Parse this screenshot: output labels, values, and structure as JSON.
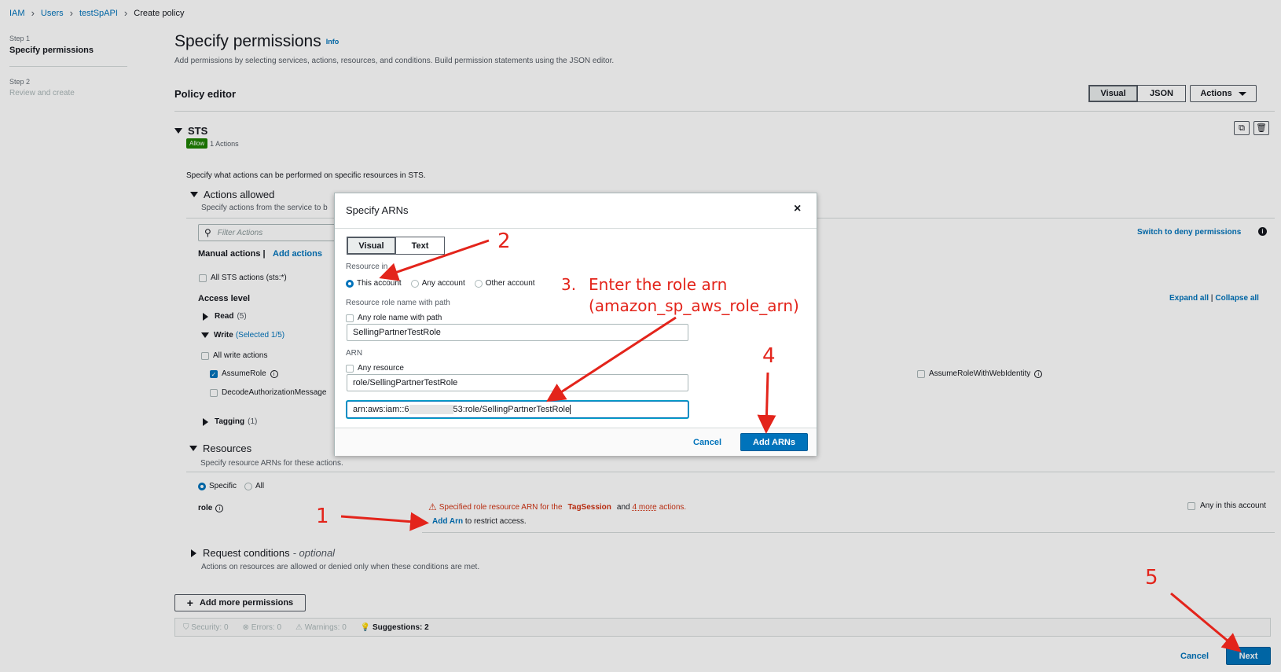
{
  "breadcrumb": {
    "iam": "IAM",
    "users": "Users",
    "user": "testSpAPI",
    "current": "Create policy"
  },
  "steps": [
    {
      "num": "Step 1",
      "label": "Specify permissions"
    },
    {
      "num": "Step 2",
      "label": "Review and create"
    }
  ],
  "page": {
    "title": "Specify permissions",
    "info": "Info",
    "subtitle": "Add permissions by selecting services, actions, resources, and conditions. Build permission statements using the JSON editor."
  },
  "editor": {
    "heading": "Policy editor",
    "visual": "Visual",
    "json": "JSON",
    "actions": "Actions"
  },
  "service": {
    "name": "STS",
    "allow": "Allow",
    "actions_count": "1 Actions",
    "desc": "Specify what actions can be performed on specific resources in STS.",
    "actions_allowed": "Actions allowed",
    "actions_allowed_desc": "Specify actions from the service to b",
    "filter_placeholder": "Filter Actions",
    "manual_actions": "Manual actions |",
    "add_actions": "Add actions",
    "switch_deny": "Switch to deny permissions",
    "all_sts": "All STS actions (sts:*)",
    "access_level": "Access level",
    "expand_all": "Expand all",
    "collapse_all": "Collapse all",
    "read": "Read",
    "read_count": "(5)",
    "write": "Write",
    "write_selected": "(Selected 1/5)",
    "all_write": "All write actions",
    "assume_role": "AssumeRole",
    "decode_auth": "DecodeAuthorizationMessage",
    "assume_web": "AssumeRoleWithWebIdentity",
    "tagging": "Tagging",
    "tagging_count": "(1)"
  },
  "resources": {
    "heading": "Resources",
    "desc": "Specify resource ARNs for these actions.",
    "specific": "Specific",
    "all": "All",
    "role": "role",
    "warning_pre": "Specified role resource ARN for the",
    "warning_action": "TagSession",
    "warning_and": "and",
    "warning_more": "4 more",
    "warning_post": "actions.",
    "add_arn": "Add Arn",
    "restrict": "to restrict access.",
    "any_account": "Any in this account"
  },
  "conditions": {
    "heading": "Request conditions",
    "optional": "- optional",
    "desc": "Actions on resources are allowed or denied only when these conditions are met."
  },
  "bottom": {
    "add_more": "Add more permissions",
    "security": "Security: 0",
    "errors": "Errors: 0",
    "warnings": "Warnings: 0",
    "suggestions": "Suggestions: 2",
    "cancel": "Cancel",
    "next": "Next"
  },
  "modal": {
    "title": "Specify ARNs",
    "close": "×",
    "tab_visual": "Visual",
    "tab_text": "Text",
    "resource_in": "Resource in",
    "this_account": "This account",
    "any_account": "Any account",
    "other_account": "Other account",
    "role_name_label": "Resource role name with path",
    "any_role_name": "Any role name with path",
    "role_name_value": "SellingPartnerTestRole",
    "arn_label": "ARN",
    "any_resource": "Any resource",
    "arn_resource_value": "role/SellingPartnerTestRole",
    "arn_prefix": "arn:aws:iam::6",
    "arn_suffix": "53:role/SellingPartnerTestRole",
    "cancel": "Cancel",
    "add_arns": "Add ARNs"
  },
  "annotations": {
    "n1": "1",
    "n2": "2",
    "n3_num": "3.",
    "n3_line1": "Enter the role arn",
    "n3_line2": "(amazon_sp_aws_role_arn)",
    "n4": "4",
    "n5": "5",
    "color": "#e3241b"
  }
}
